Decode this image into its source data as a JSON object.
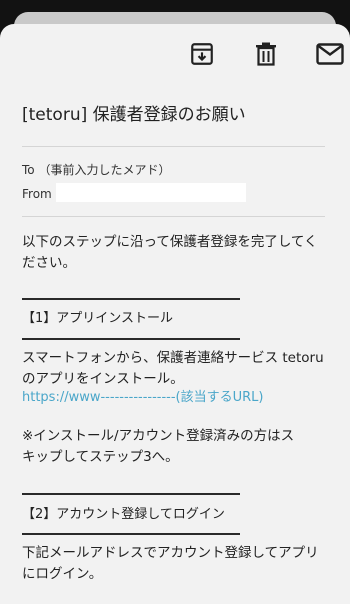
{
  "toolbar": {
    "archive_icon": "archive-icon",
    "delete_icon": "trash-icon",
    "mail_icon": "mail-icon"
  },
  "email": {
    "subject": "[tetoru] 保護者登録のお願い",
    "to_line": "To （事前入力したメアド）",
    "from_label": "From",
    "from_value": ""
  },
  "body": {
    "intro": "以下のステップに沿って保護者登録を完了してく\nださい。",
    "step1_title": "【1】アプリインストール",
    "step1_text": "スマートフォンから、保護者連絡サービス tetoru\nのアプリをインストール。",
    "step1_link": "https://www----------------(該当するURL)",
    "step1_note": "※インストール/アカウント登録済みの方はス\nキップしてステップ3へ。",
    "step2_title": "【2】アカウント登録してログイン",
    "step2_text": "下記メールアドレスでアカウント登録してアプリ\nにログイン。"
  },
  "colors": {
    "link": "#4aa6c9",
    "sheet": "#f2f2f2",
    "background": "#121212"
  }
}
